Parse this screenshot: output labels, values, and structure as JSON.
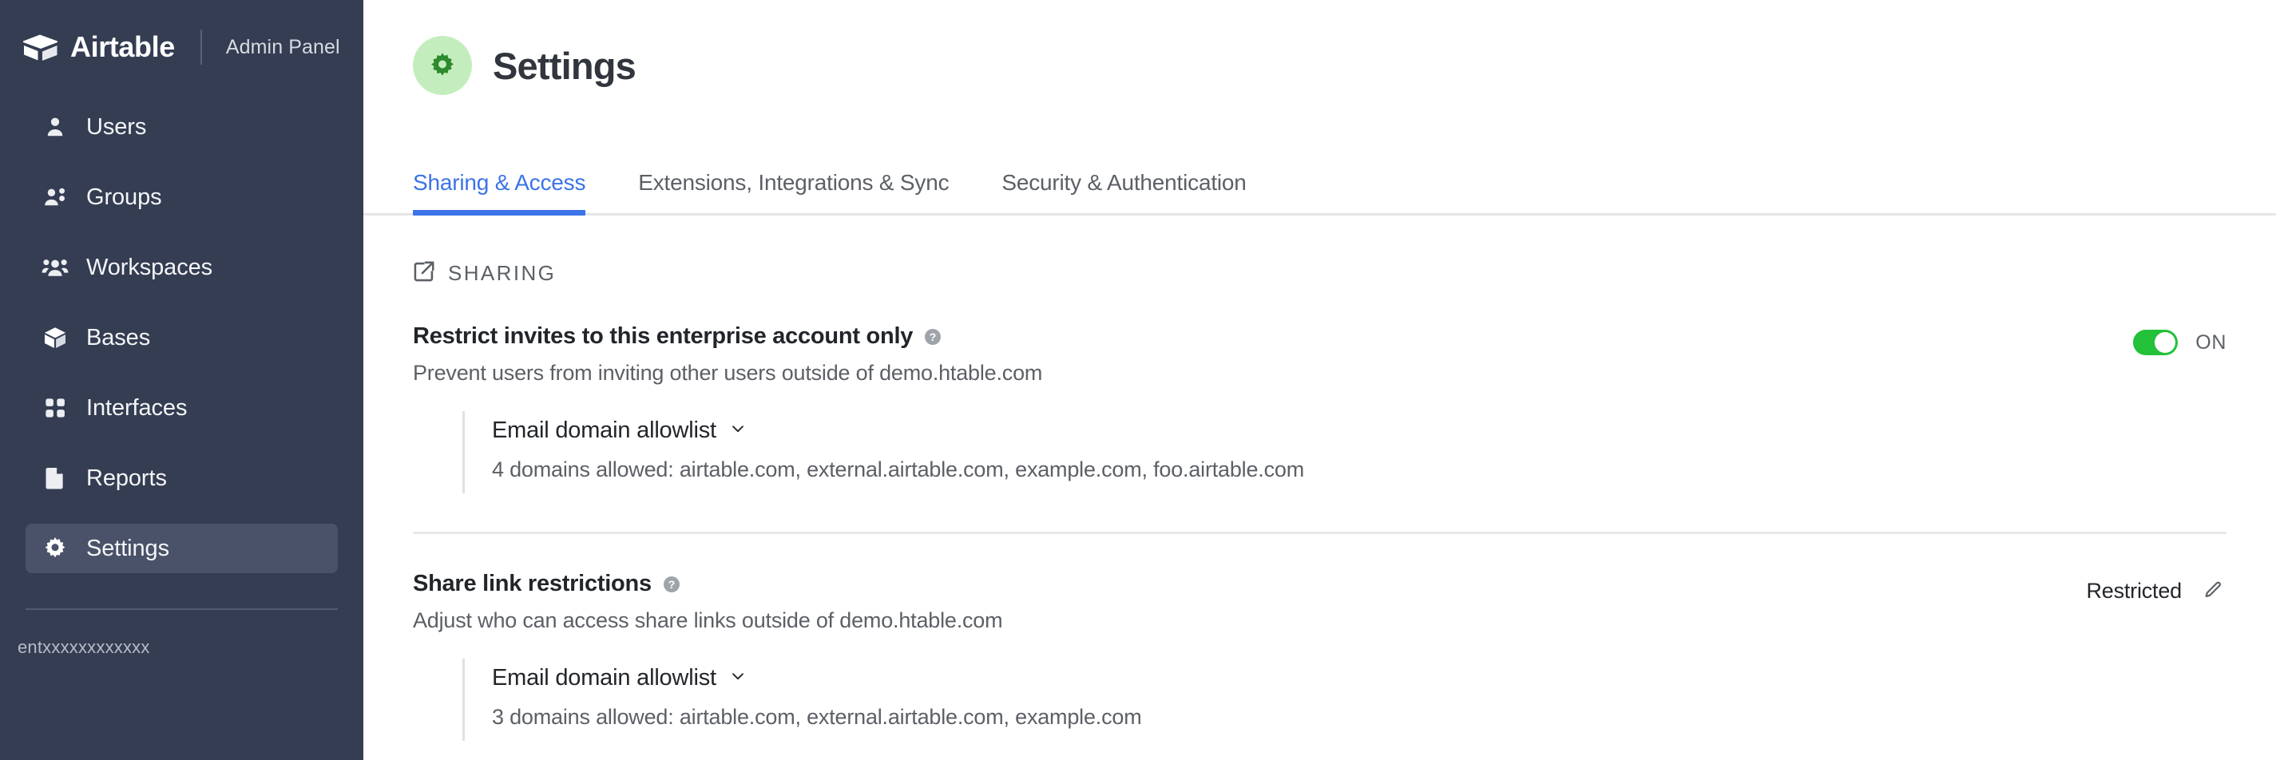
{
  "sidebar": {
    "brand": {
      "name": "Airtable",
      "subtitle": "Admin Panel",
      "logo_icon": "airtable-logo-icon"
    },
    "items": [
      {
        "label": "Users",
        "icon": "user-icon",
        "active": false
      },
      {
        "label": "Groups",
        "icon": "users-two-icon",
        "active": false
      },
      {
        "label": "Workspaces",
        "icon": "users-group-icon",
        "active": false
      },
      {
        "label": "Bases",
        "icon": "cube-icon",
        "active": false
      },
      {
        "label": "Interfaces",
        "icon": "grid-dots-icon",
        "active": false
      },
      {
        "label": "Reports",
        "icon": "document-icon",
        "active": false
      },
      {
        "label": "Settings",
        "icon": "gear-icon",
        "active": true
      }
    ],
    "footer_text": "entxxxxxxxxxxxx"
  },
  "header": {
    "title": "Settings",
    "badge_icon": "gear-icon",
    "badge_bg": "#c4edbe",
    "badge_fg": "#2d8a2d"
  },
  "tabs": [
    {
      "label": "Sharing & Access",
      "active": true
    },
    {
      "label": "Extensions, Integrations & Sync",
      "active": false
    },
    {
      "label": "Security & Authentication",
      "active": false
    }
  ],
  "accent_color": "#3b73e8",
  "sections": [
    {
      "heading": "SHARING",
      "heading_icon": "external-link-icon",
      "settings": [
        {
          "title": "Restrict invites to this enterprise account only",
          "help_icon": "help-circle-icon",
          "description": "Prevent users from inviting other users outside of demo.htable.com",
          "control_type": "toggle",
          "toggle_state": "ON",
          "toggle_on_color": "#23c03a",
          "sub": {
            "title": "Email domain allowlist",
            "chevron_icon": "chevron-down-icon",
            "description": "4 domains allowed: airtable.com, external.airtable.com, example.com, foo.airtable.com"
          }
        },
        {
          "title": "Share link restrictions",
          "help_icon": "help-circle-icon",
          "description": "Adjust who can access share links outside of demo.htable.com",
          "control_type": "value",
          "value": "Restricted",
          "edit_icon": "pencil-icon",
          "sub": {
            "title": "Email domain allowlist",
            "chevron_icon": "chevron-down-icon",
            "description": "3 domains allowed: airtable.com, external.airtable.com, example.com"
          }
        }
      ]
    }
  ]
}
